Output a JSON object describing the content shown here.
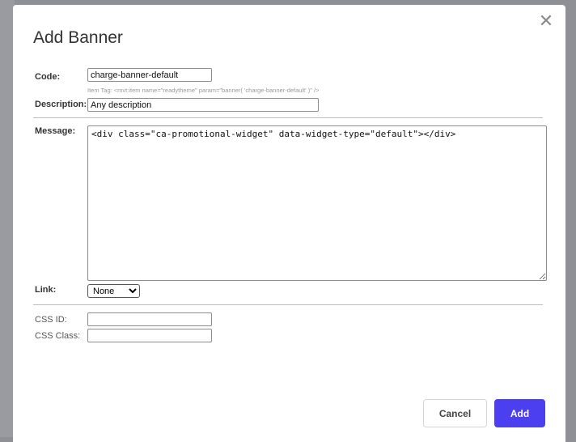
{
  "dialog": {
    "title": "Add Banner",
    "close_glyph": "✕"
  },
  "form": {
    "code": {
      "label": "Code:",
      "value": "charge-banner-default"
    },
    "item_tag_hint": "Item Tag: <mvt:item name=\"readytheme\" param=\"banner( 'charge-banner-default' )\" />",
    "description": {
      "label": "Description:",
      "value": "Any description"
    },
    "message": {
      "label": "Message:",
      "value": "<div class=\"ca-promotional-widget\" data-widget-type=\"default\"></div>"
    },
    "link": {
      "label": "Link:",
      "selected": "None"
    },
    "css_id": {
      "label": "CSS ID:",
      "value": ""
    },
    "css_class": {
      "label": "CSS Class:",
      "value": ""
    }
  },
  "actions": {
    "cancel_label": "Cancel",
    "add_label": "Add"
  },
  "colors": {
    "accent": "#4b3ff0",
    "backdrop": "#8f8f96"
  }
}
